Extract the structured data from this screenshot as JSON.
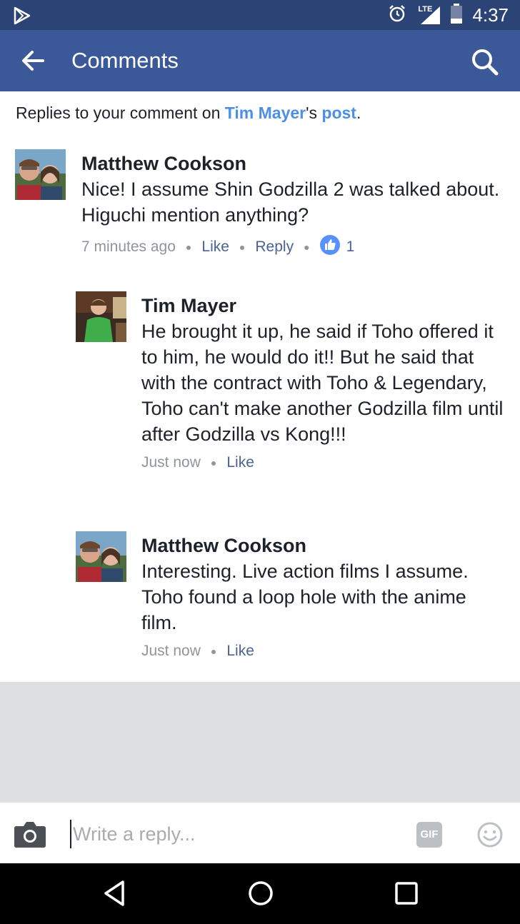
{
  "status_bar": {
    "network": "LTE",
    "time": "4:37"
  },
  "app_bar": {
    "title": "Comments"
  },
  "replies_header": {
    "prefix": "Replies to your comment on ",
    "author": "Tim Mayer",
    "possessive": "'s ",
    "post_link": "post",
    "suffix": "."
  },
  "comments": [
    {
      "name": "Matthew Cookson",
      "text": "Nice! I assume Shin Godzilla 2 was talked about. Higuchi mention anything?",
      "time": "7 minutes ago",
      "like_label": "Like",
      "reply_label": "Reply",
      "like_count": "1"
    },
    {
      "name": "Tim Mayer",
      "text": "He brought it up, he said if Toho offered it to him, he would do it!! But he said that with the contract with Toho & Legendary, Toho can't make another Godzilla film until after Godzilla vs Kong!!!",
      "time": "Just now",
      "like_label": "Like"
    },
    {
      "name": "Matthew Cookson",
      "text": "Interesting. Live action films I assume. Toho found a loop hole with the anime film.",
      "time": "Just now",
      "like_label": "Like"
    }
  ],
  "composer": {
    "placeholder": "Write a reply...",
    "gif_label": "GIF"
  },
  "colors": {
    "status_bar": "#2c4376",
    "app_bar": "#3b5998",
    "link": "#4d8fe6",
    "action": "#4b6294",
    "meta": "#90949c",
    "like_badge": "#5890ff"
  }
}
